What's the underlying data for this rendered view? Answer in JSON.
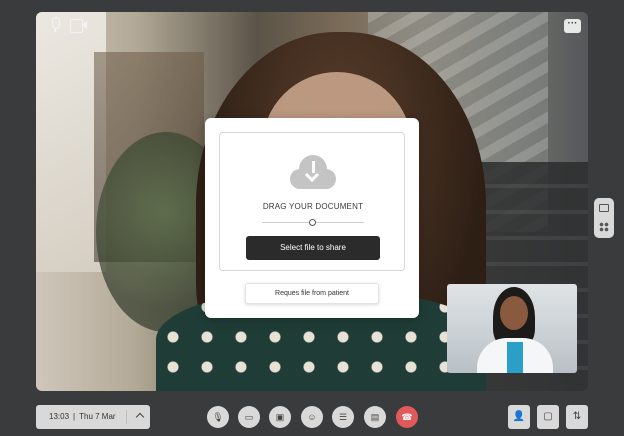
{
  "modal": {
    "drag_label": "DRAG YOUR DOCUMENT",
    "select_button": "Select file to share",
    "request_button": "Reques file from patient"
  },
  "call": {
    "time": "13:03",
    "date": "Thu 7 Mar"
  },
  "icons": {
    "more": "more-icon",
    "top_mic": "microphone-icon",
    "top_camera": "camera-icon",
    "controls": [
      "microphone-icon",
      "camera-icon",
      "screen-share-icon",
      "emoji-icon",
      "list-icon",
      "document-icon",
      "end-call-icon"
    ],
    "right": [
      "person-icon",
      "chat-icon",
      "settings-sliders-icon"
    ]
  },
  "colors": {
    "end_call": "#e05a5a",
    "primary_button": "#2b2b2c",
    "frame": "#3a3b3d"
  }
}
